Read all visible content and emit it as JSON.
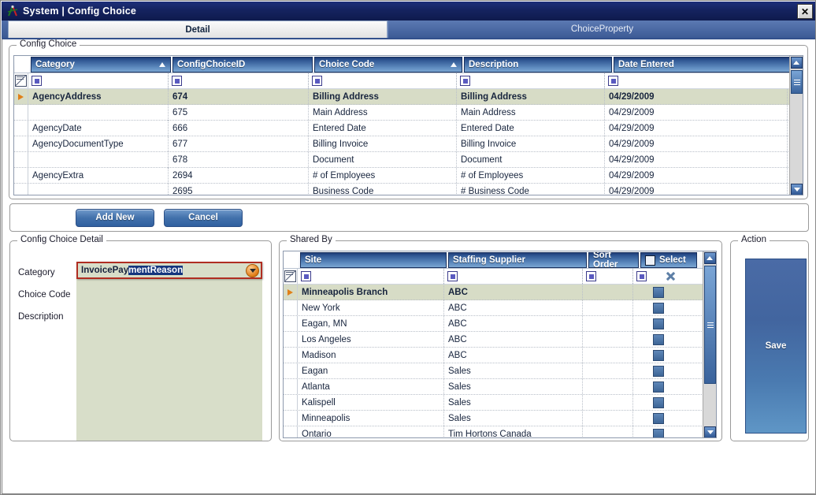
{
  "window": {
    "title": "System | Config Choice",
    "icon": "compass-icon",
    "close_label": "✕"
  },
  "tabs": [
    {
      "label": "Detail",
      "active": true
    },
    {
      "label": "ChoiceProperty",
      "active": false
    }
  ],
  "config_choice_group": {
    "title": "Config Choice",
    "columns": [
      "Category",
      "ConfigChoiceID",
      "Choice Code",
      "Description",
      "Date Entered"
    ],
    "sorted_columns": [
      "Category",
      "Choice Code"
    ],
    "rows": [
      {
        "category": "AgencyAddress",
        "category_span": 2,
        "id": "674",
        "code": "Billing Address",
        "description": "Billing Address",
        "date": "04/29/2009",
        "selected": true
      },
      {
        "category": "",
        "category_span": 0,
        "id": "675",
        "code": "Main Address",
        "description": "Main Address",
        "date": "04/29/2009",
        "selected": false
      },
      {
        "category": "AgencyDate",
        "category_span": 1,
        "id": "666",
        "code": "Entered Date",
        "description": "Entered Date",
        "date": "04/29/2009",
        "selected": false
      },
      {
        "category": "AgencyDocumentType",
        "category_span": 2,
        "id": "677",
        "code": "Billing Invoice",
        "description": "Billing Invoice",
        "date": "04/29/2009",
        "selected": false
      },
      {
        "category": "",
        "category_span": 0,
        "id": "678",
        "code": "Document",
        "description": "Document",
        "date": "04/29/2009",
        "selected": false
      },
      {
        "category": "AgencyExtra",
        "category_span": 2,
        "id": "2694",
        "code": "# of Employees",
        "description": "# of Employees",
        "date": "04/29/2009",
        "selected": false
      },
      {
        "category": "",
        "category_span": 0,
        "id": "2695",
        "code": "Business Code",
        "description": "# Business Code",
        "date": "04/29/2009",
        "selected": false
      }
    ]
  },
  "action_bar": {
    "add_new_label": "Add New",
    "cancel_label": "Cancel"
  },
  "detail_panel": {
    "title": "Config Choice  Detail",
    "fields": [
      {
        "label": "Category"
      },
      {
        "label": "Choice Code"
      },
      {
        "label": "Description"
      }
    ],
    "category_value_typed": "InvoicePay",
    "category_value_completed": "mentReason",
    "choice_code_value": "",
    "description_value": ""
  },
  "shared_by": {
    "title": "Shared By",
    "columns": [
      "Site",
      "Staffing Supplier",
      "Sort Order",
      "Select"
    ],
    "rows": [
      {
        "site": "Minneapolis Branch",
        "supplier": "ABC",
        "sort_order": "",
        "selected": true
      },
      {
        "site": "New York",
        "supplier": "ABC",
        "sort_order": "",
        "selected": false
      },
      {
        "site": "Eagan, MN",
        "supplier": "ABC",
        "sort_order": "",
        "selected": false
      },
      {
        "site": "Los Angeles",
        "supplier": "ABC",
        "sort_order": "",
        "selected": false
      },
      {
        "site": "Madison",
        "supplier": "ABC",
        "sort_order": "",
        "selected": false
      },
      {
        "site": "Eagan",
        "supplier": "Sales",
        "sort_order": "",
        "selected": false
      },
      {
        "site": "Atlanta",
        "supplier": "Sales",
        "sort_order": "",
        "selected": false
      },
      {
        "site": "Kalispell",
        "supplier": "Sales",
        "sort_order": "",
        "selected": false
      },
      {
        "site": "Minneapolis",
        "supplier": "Sales",
        "sort_order": "",
        "selected": false
      },
      {
        "site": "Ontario",
        "supplier": "Tim Hortons Canada",
        "sort_order": "",
        "selected": false
      }
    ]
  },
  "action_panel": {
    "title": "Action",
    "save_label": "Save"
  },
  "colors": {
    "titlebar": "#15235f",
    "header_blue": "#2f5692",
    "selected_row": "#d7dcc6",
    "field_green": "#d8dec9",
    "focus_red": "#b02d21",
    "accent_orange": "#e07b14",
    "highlight_navy": "#14357e"
  }
}
